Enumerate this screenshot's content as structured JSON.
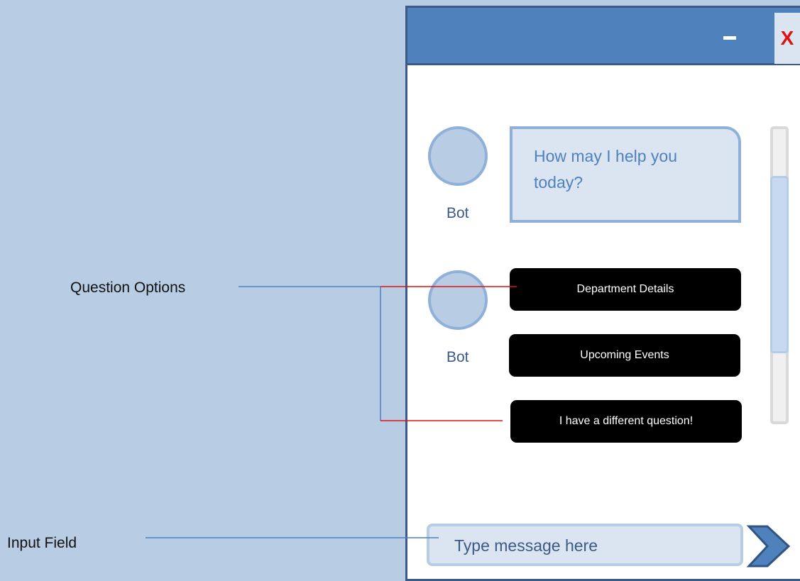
{
  "annotations": {
    "question_options": "Question Options",
    "input_field": "Input Field"
  },
  "window": {
    "minimize_icon": "minimize-icon",
    "close_label": "X"
  },
  "chat": {
    "bot_message": {
      "sender": "Bot",
      "text": "How may I help you today?"
    },
    "options_sender": "Bot",
    "options": [
      "Department Details",
      "Upcoming Events",
      "I have a different question!"
    ]
  },
  "input": {
    "placeholder": "Type message here",
    "send_icon": "chevron-right-icon"
  },
  "colors": {
    "background": "#b8cce4",
    "title_bar": "#4f81bd",
    "close_x": "#e01010",
    "option_button": "#000000",
    "connector_red": "#e01010",
    "connector_blue": "#4f81bd"
  }
}
